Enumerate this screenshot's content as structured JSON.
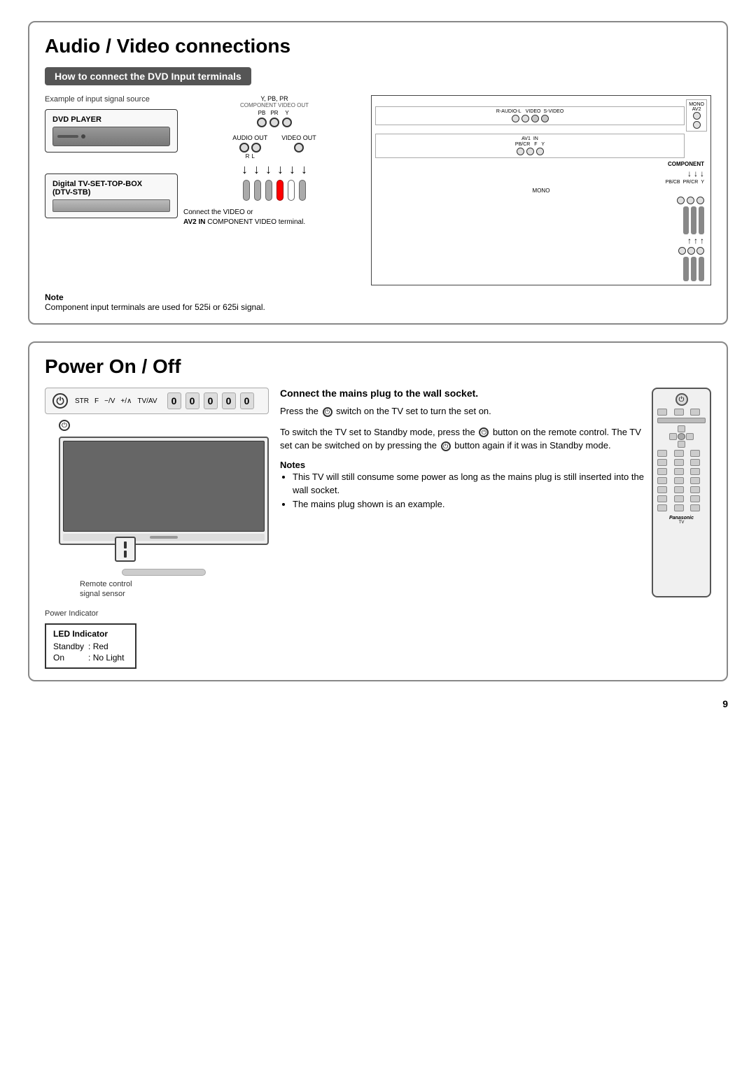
{
  "page": {
    "number": "9"
  },
  "section1": {
    "title": "Audio / Video connections",
    "subsection": "How to connect the DVD Input terminals",
    "example_label": "Example of input signal source",
    "device1_label": "DVD PLAYER",
    "device2_label": "Digital TV-SET-TOP-BOX",
    "device2_sub": "(DTV-STB)",
    "labels": {
      "component_video_out": "COMPONENT VIDEO OUT",
      "y_pb_pr": "Y, PB, PR",
      "audio_out": "AUDIO OUT",
      "video_out": "VIDEO OUT",
      "pb": "PB",
      "pr": "PR",
      "y": "Y",
      "r": "R",
      "l": "L",
      "av2_in": "AV2 IN",
      "connect_video": "Connect the VIDEO or",
      "component_video_terminal": "COMPONENT VIDEO terminal.",
      "mono": "MONO",
      "component": "COMPONENT"
    },
    "panel_labels": {
      "r_audio_l": "R-AUDIO-L",
      "video": "VIDEO",
      "s_video": "S-VIDEO",
      "av2": "AV2",
      "av1_in": "AV1 IN",
      "pb_cr": "PB/CR",
      "pb_cb": "PB/CB",
      "f": "F",
      "y": "Y"
    },
    "note_label": "Note",
    "note_text": "Component input terminals are used for 525i or 625i signal."
  },
  "section2": {
    "title": "Power On / Off",
    "connect_header": "Connect the mains plug to the wall socket.",
    "press_instruction": "Press the",
    "switch_text": "switch on the TV set to turn the set on.",
    "standby_text": "To switch the TV set to Standby mode, press the",
    "standby_text2": "button on the remote control. The TV set can be switched on by pressing the",
    "standby_text3": "button again if it was in Standby mode.",
    "notes_label": "Notes",
    "note1": "This TV will still consume some power as long as the mains plug is still inserted into the wall socket.",
    "note2": "The mains plug shown is an example.",
    "led_title": "LED Indicator",
    "led_standby_label": "Standby",
    "led_standby_value": ": Red",
    "led_on_label": "On",
    "led_on_value": ": No Light",
    "power_indicator_label": "Power Indicator",
    "remote_control_label": "Remote control",
    "signal_sensor_label": "signal sensor",
    "remote_bar_labels": {
      "str": "STR",
      "f": "F",
      "minus_v": "−/V",
      "plus_a": "+/∧",
      "tv_av": "TV/AV"
    },
    "panasonic_label": "Panasonic"
  }
}
